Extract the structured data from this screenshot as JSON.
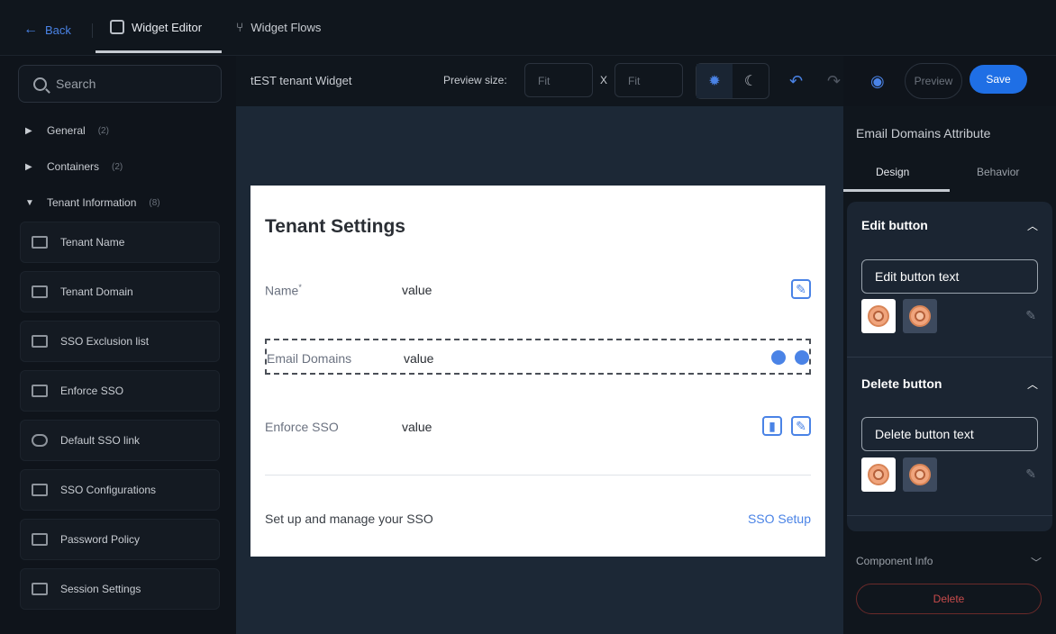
{
  "topbar": {
    "back_label": "Back",
    "tabs": [
      {
        "label": "Widget Editor",
        "active": true
      },
      {
        "label": "Widget Flows",
        "active": false
      }
    ]
  },
  "sidebar": {
    "search_placeholder": "Search",
    "groups": [
      {
        "label": "General",
        "count": "(2)",
        "expanded": false
      },
      {
        "label": "Containers",
        "count": "(2)",
        "expanded": false
      },
      {
        "label": "Tenant Information",
        "count": "(8)",
        "expanded": true
      }
    ],
    "items": [
      {
        "label": "Tenant Name"
      },
      {
        "label": "Tenant Domain"
      },
      {
        "label": "SSO Exclusion list"
      },
      {
        "label": "Enforce SSO"
      },
      {
        "label": "Default SSO link"
      },
      {
        "label": "SSO Configurations"
      },
      {
        "label": "Password Policy"
      },
      {
        "label": "Session Settings"
      }
    ]
  },
  "canvas_header": {
    "widget_title": "tEST tenant Widget",
    "preview_size_label": "Preview size:",
    "width_placeholder": "Fit",
    "separator": "X",
    "height_placeholder": "Fit",
    "preview_label": "Preview",
    "save_label": "Save"
  },
  "card": {
    "title": "Tenant Settings",
    "rows": [
      {
        "label": "Name",
        "required_mark": "*",
        "value": "value"
      },
      {
        "label": "Email Domains",
        "value": "value"
      },
      {
        "label": "Enforce SSO",
        "value": "value"
      }
    ],
    "footer_text": "Set up and manage your SSO",
    "footer_link": "SSO Setup"
  },
  "right_panel": {
    "title": "Email Domains Attribute",
    "tabs": [
      "Design",
      "Behavior"
    ],
    "sections": [
      {
        "title": "Edit button",
        "text_value": "Edit button text"
      },
      {
        "title": "Delete button",
        "text_value": "Delete button text"
      }
    ],
    "footer_section": "Component Info",
    "delete_label": "Delete"
  },
  "colors": {
    "accent": "#4a83e6",
    "save": "#1f6fe5",
    "panel": "#1b2532",
    "canvas": "#1c2836"
  }
}
